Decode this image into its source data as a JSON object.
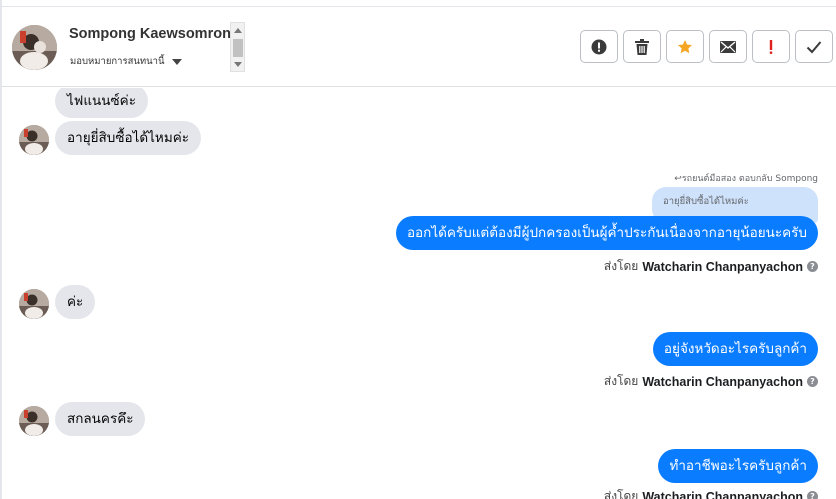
{
  "header": {
    "contact_name": "Sompong Kaewsomrong",
    "assign_label": "มอบหมายการสนทนานี้"
  },
  "actions": [
    {
      "name": "report-button",
      "icon": "alert-circle-icon",
      "color": "#3a3a3a"
    },
    {
      "name": "delete-button",
      "icon": "trash-icon",
      "color": "#3a3a3a"
    },
    {
      "name": "star-button",
      "icon": "star-icon",
      "color": "#f5a623"
    },
    {
      "name": "mail-button",
      "icon": "envelope-icon",
      "color": "#3a3a3a"
    },
    {
      "name": "important-button",
      "icon": "exclamation-icon",
      "color": "#e02020"
    },
    {
      "name": "done-button",
      "icon": "check-icon",
      "color": "#3a3a3a"
    }
  ],
  "messages": {
    "in_1": "ไฟแนนซ์ค่ะ",
    "in_2": "อายุยี่สิบซื้อได้ไหมค่ะ",
    "reply_note": "รถยนต์มือสอง ตอบกลับ Sompong",
    "quoted_text": "อายุยี่สิบซื้อได้ไหมค่ะ",
    "out_1": "ออกได้ครับแต่ต้องมีผู้ปกครองเป็นผู้ค้ำประกันเนื่องจากอายุน้อยนะครับ",
    "in_3": "ค่ะ",
    "out_2": "อยู่จังหวัดอะไรครับลูกค้า",
    "in_4": "สกลนครคึะ",
    "out_3": "ทำอาชีพอะไรครับลูกค้า"
  },
  "sent_by": {
    "prefix": "ส่งโดย",
    "agent": "Watcharin Chanpanyachon",
    "help": "?"
  },
  "colors": {
    "outgoing_bubble": "#0a7cff",
    "incoming_bubble": "#e4e6eb",
    "quoted_bubble": "#cfe2fb"
  }
}
